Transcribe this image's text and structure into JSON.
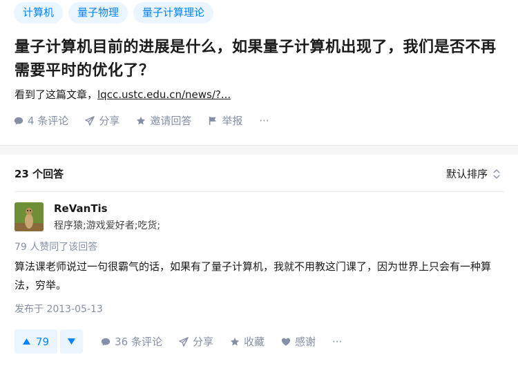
{
  "question": {
    "tags": [
      "计算机",
      "量子物理",
      "量子计算理论"
    ],
    "title": "量子计算机目前的进展是什么，如果量子计算机出现了，我们是否不再需要平时的优化了？",
    "detail_prefix": "看到了这篇文章，",
    "detail_link": "lqcc.ustc.edu.cn/news/?...",
    "actions": {
      "comments": "4 条评论",
      "share": "分享",
      "invite": "邀请回答",
      "report": "举报",
      "more": "···"
    }
  },
  "answers": {
    "count_label": "23 个回答",
    "sort_label": "默认排序"
  },
  "answer": {
    "author_name": "ReVanTis",
    "author_bio": "程序猿;游戏爱好者;吃货;",
    "vote_info": "79 人赞同了该回答",
    "content": "算法课老师说过一句很霸气的话，如果有了量子计算机，我就不用教这门课了，因为世界上只会有一种算法，穷举。",
    "published": "发布于 2013-05-13",
    "upvotes": "79",
    "actions": {
      "comments": "36 条评论",
      "share": "分享",
      "collect": "收藏",
      "thanks": "感谢",
      "more": "···"
    }
  },
  "colors": {
    "accent": "#0084ff",
    "muted": "#8590a6",
    "tag_bg": "#ebf5ff"
  }
}
